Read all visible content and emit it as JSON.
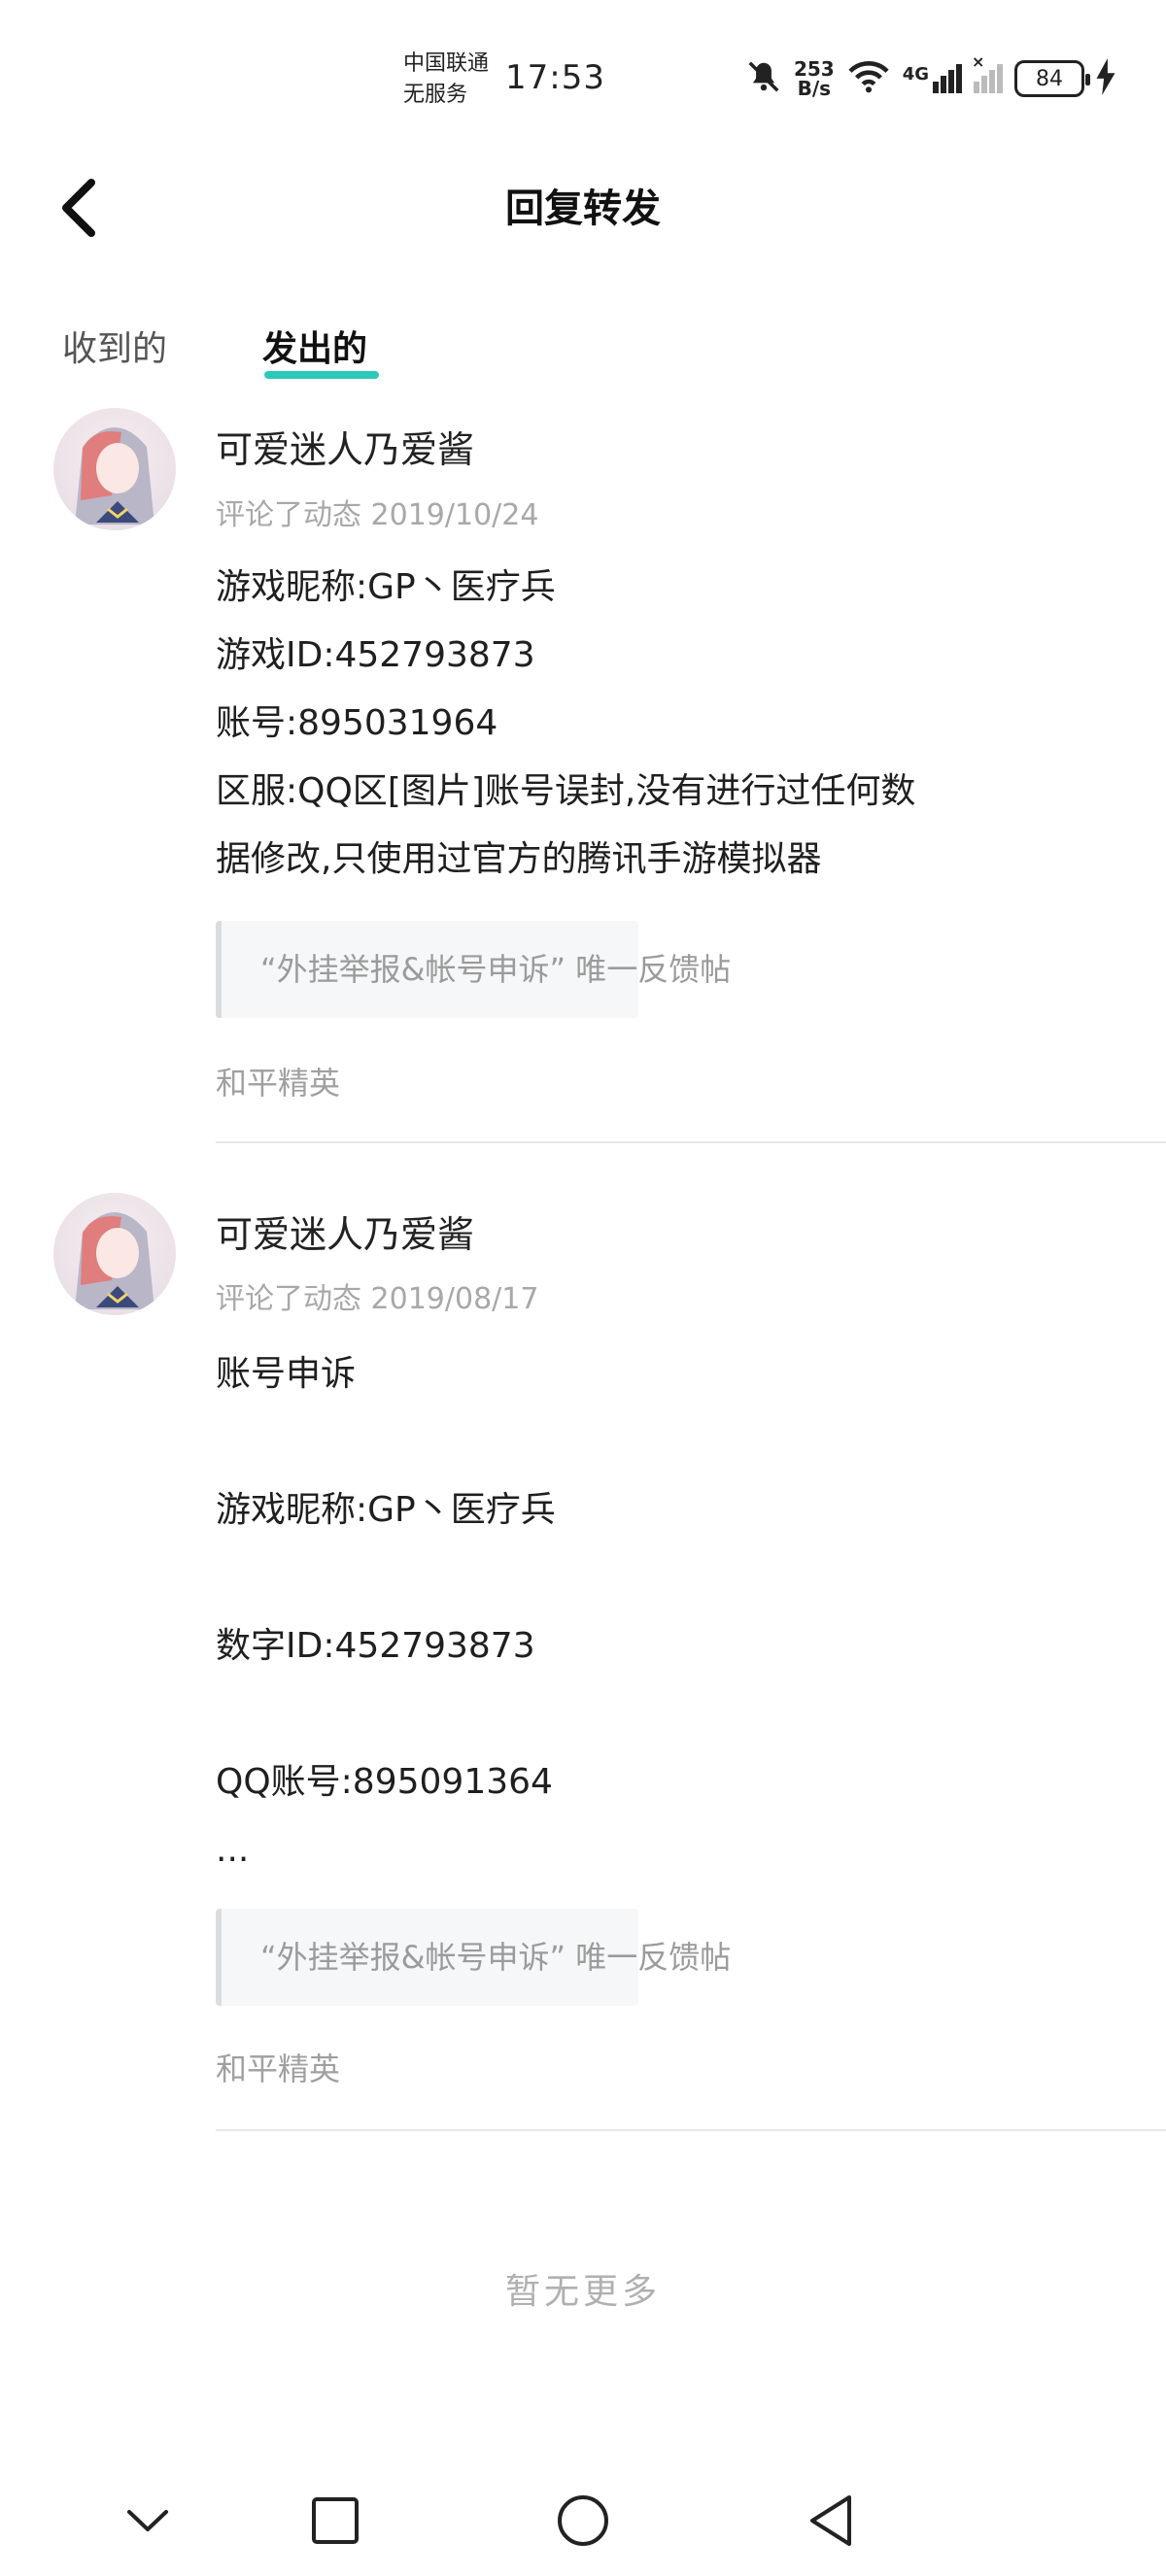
{
  "status_bar": {
    "carrier_line1": "中国联通",
    "carrier_line2": "无服务",
    "time": "17:53",
    "net_speed_value": "253",
    "net_speed_unit": "B/s",
    "network_type": "4G",
    "battery_level": "84"
  },
  "header": {
    "title": "回复转发"
  },
  "tabs": [
    {
      "label": "收到的",
      "active": false
    },
    {
      "label": "发出的",
      "active": true
    }
  ],
  "accent_color": "#2bcab8",
  "posts": [
    {
      "author": "可爱迷人乃爱酱",
      "meta": "评论了动态 2019/10/24",
      "lines": [
        "游戏昵称:GP丶医疗兵",
        "游戏ID:452793873",
        "账号:895031964",
        "区服:QQ区[图片]账号误封,没有进行过任何数",
        "据修改,只使用过官方的腾讯手游模拟器"
      ],
      "topic": "“外挂举报&帐号申诉” 唯一反馈帖",
      "community": "和平精英"
    },
    {
      "author": "可爱迷人乃爱酱",
      "meta": "评论了动态 2019/08/17",
      "lines": [
        "账号申诉",
        "",
        "游戏昵称:GP丶医疗兵",
        "",
        "数字ID:452793873",
        "",
        "QQ账号:895091364",
        "..."
      ],
      "topic": "“外挂举报&帐号申诉” 唯一反馈帖",
      "community": "和平精英"
    }
  ],
  "footer": {
    "no_more": "暂无更多"
  }
}
